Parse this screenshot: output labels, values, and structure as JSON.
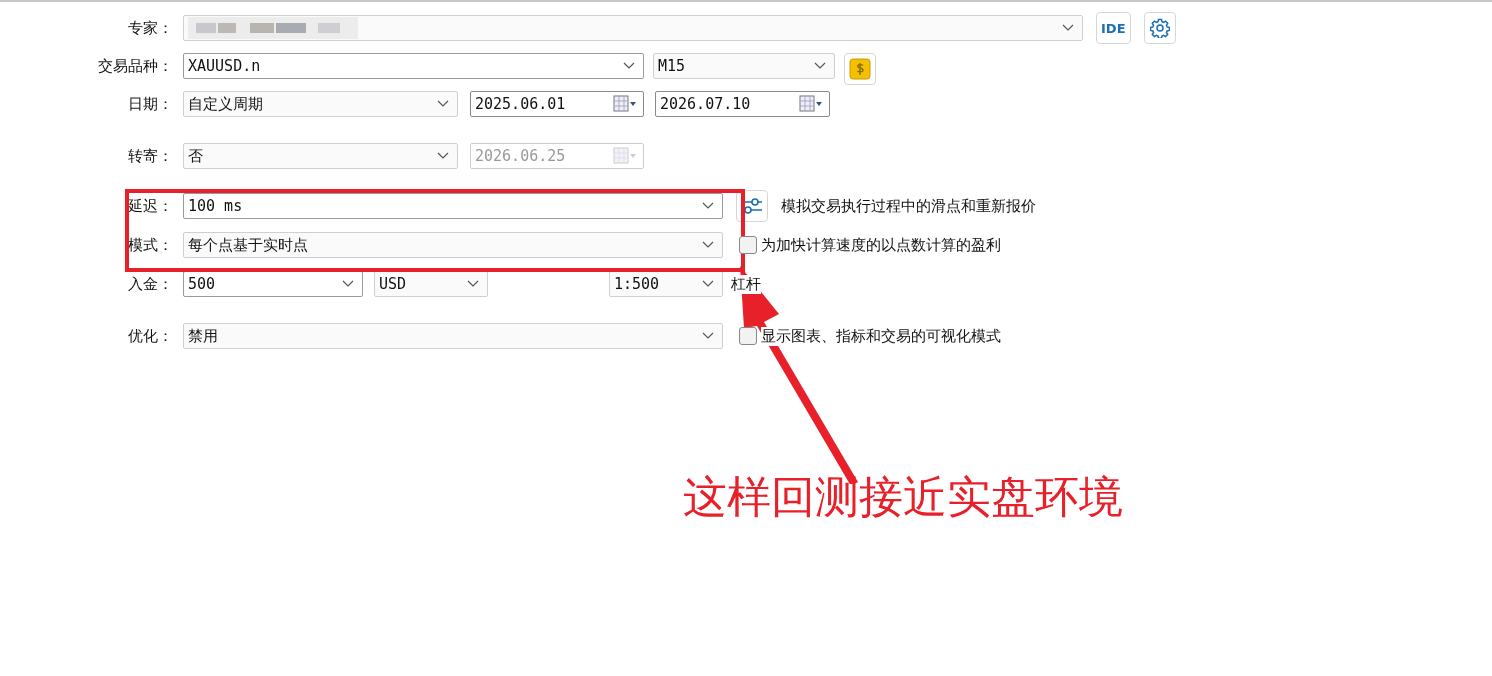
{
  "expert": {
    "label": "专家："
  },
  "tool_buttons": [
    {
      "kind": "ide",
      "label": "IDE"
    },
    {
      "kind": "gear"
    }
  ],
  "symbol": {
    "label": "交易品种：",
    "value": "XAUUSD.n",
    "timeframe": "M15"
  },
  "date": {
    "label": "日期：",
    "value": "自定义周期",
    "from": "2025.06.01",
    "to": "2026.07.10"
  },
  "forward": {
    "label": "转寄：",
    "value": "否",
    "date": "2026.06.25",
    "disabled": true
  },
  "delay": {
    "label": "延迟：",
    "value": "100 ms",
    "note": "模拟交易执行过程中的滑点和重新报价"
  },
  "mode": {
    "label": "模式：",
    "value": "每个点基于实时点",
    "option": {
      "label": "为加快计算速度的以点数计算的盈利",
      "checked": false
    }
  },
  "deposit": {
    "label": "入金：",
    "value": "500",
    "currency": "USD",
    "leverage": "1:500",
    "leverage_label": "杠杆"
  },
  "optimization": {
    "label": "优化：",
    "value": "禁用",
    "option": {
      "label": "显示图表、指标和交易的可视化模式",
      "checked": false
    }
  },
  "annotation": {
    "text": "这样回测接近实盘环境"
  }
}
